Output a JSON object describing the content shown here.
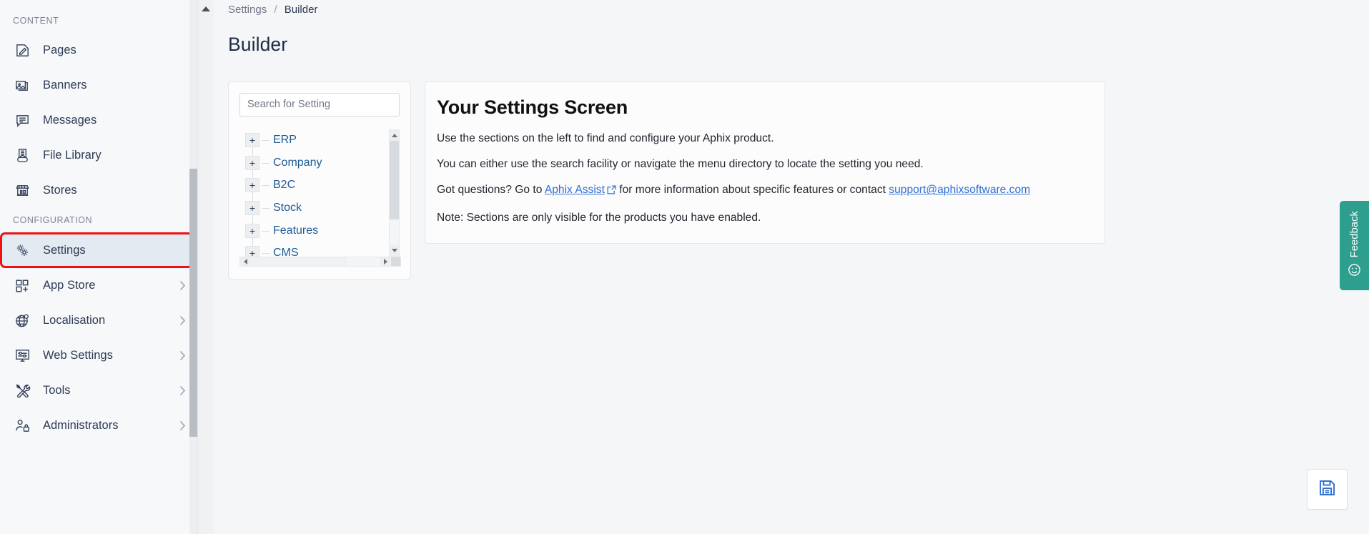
{
  "sidebar": {
    "sections": [
      {
        "label": "CONTENT",
        "items": [
          {
            "label": "Pages",
            "icon": "pages-icon",
            "chevron": false,
            "selected": false
          },
          {
            "label": "Banners",
            "icon": "banners-icon",
            "chevron": false,
            "selected": false
          },
          {
            "label": "Messages",
            "icon": "messages-icon",
            "chevron": false,
            "selected": false
          },
          {
            "label": "File Library",
            "icon": "file-library-icon",
            "chevron": false,
            "selected": false
          },
          {
            "label": "Stores",
            "icon": "stores-icon",
            "chevron": false,
            "selected": false
          }
        ]
      },
      {
        "label": "CONFIGURATION",
        "items": [
          {
            "label": "Settings",
            "icon": "gear-icon",
            "chevron": false,
            "selected": true
          },
          {
            "label": "App Store",
            "icon": "app-store-icon",
            "chevron": true,
            "selected": false
          },
          {
            "label": "Localisation",
            "icon": "globe-icon",
            "chevron": true,
            "selected": false
          },
          {
            "label": "Web Settings",
            "icon": "web-settings-icon",
            "chevron": true,
            "selected": false
          },
          {
            "label": "Tools",
            "icon": "tools-icon",
            "chevron": true,
            "selected": false
          },
          {
            "label": "Administrators",
            "icon": "administrators-icon",
            "chevron": true,
            "selected": false
          }
        ]
      }
    ],
    "highlight_color": "#ee1111",
    "selected_bg": "#e3eaf2"
  },
  "breadcrumb": {
    "parent": "Settings",
    "separator": "/",
    "current": "Builder"
  },
  "page": {
    "title": "Builder"
  },
  "tree_panel": {
    "search": {
      "placeholder": "Search for Setting",
      "value": ""
    },
    "nodes": [
      {
        "label": "ERP",
        "toggle": "+"
      },
      {
        "label": "Company",
        "toggle": "+"
      },
      {
        "label": "B2C",
        "toggle": "+"
      },
      {
        "label": "Stock",
        "toggle": "+"
      },
      {
        "label": "Features",
        "toggle": "+"
      },
      {
        "label": "CMS",
        "toggle": "+"
      }
    ]
  },
  "info_card": {
    "title": "Your Settings Screen",
    "p1": "Use the sections on the left to find and configure your Aphix product.",
    "p2": "You can either use the search facility or navigate the menu directory to locate the setting you need.",
    "p3_before": "Got questions? Go to ",
    "p3_link": "Aphix Assist",
    "p3_middle": " for more information about specific features or contact ",
    "p3_email": "support@aphixsoftware.com",
    "p4": "Note: Sections are only visible for the products you have enabled.",
    "link_color": "#2f6fd0"
  },
  "feedback": {
    "label": "Feedback",
    "icon": "smiley-icon",
    "color": "#2e9e8e"
  },
  "save_button": {
    "icon": "save-floppy-icon",
    "color": "#2f6fd0"
  }
}
